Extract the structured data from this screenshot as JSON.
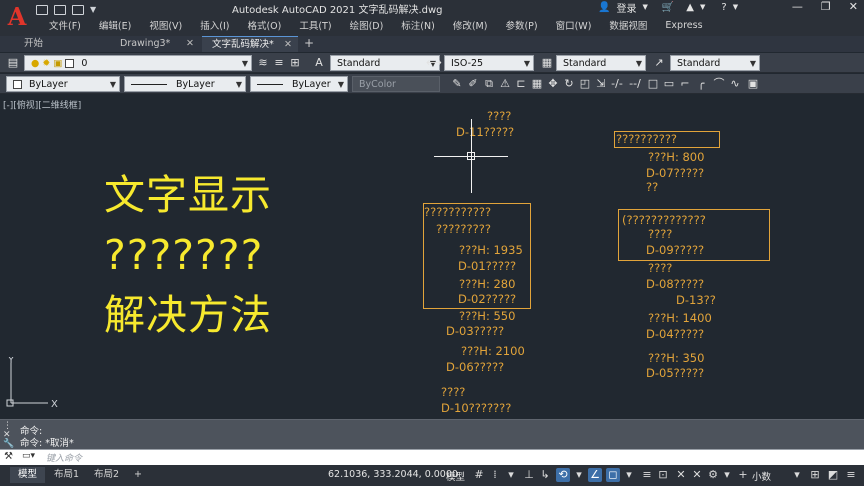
{
  "app": {
    "title": "Autodesk AutoCAD 2021    文字乱码解决.dwg",
    "account": "登录",
    "logo_letter": "A"
  },
  "menu": [
    "文件(F)",
    "编辑(E)",
    "视图(V)",
    "插入(I)",
    "格式(O)",
    "工具(T)",
    "绘图(D)",
    "标注(N)",
    "修改(M)",
    "参数(P)",
    "窗口(W)",
    "数据视图",
    "Express"
  ],
  "tabs": [
    {
      "label": "开始"
    },
    {
      "label": "Drawing3*"
    },
    {
      "label": "文字乱码解决*"
    }
  ],
  "toolbar1": {
    "layer_value": "0",
    "text_style": "Standard",
    "dim_style": "ISO-25",
    "table_style": "Standard",
    "mleader_style": "Standard"
  },
  "toolbar2": {
    "color": "ByLayer",
    "linetype": "ByLayer",
    "lineweight": "ByLayer",
    "plotstyle": "ByColor"
  },
  "viewport_label": "[-][俯视][二维线框]",
  "overlay": {
    "line1": "文字显示",
    "line2": "???????",
    "line3": "解决方法"
  },
  "drawing_texts": [
    "????",
    "D-11?????",
    "??????????",
    "???H: 800",
    "D-07?????",
    "??",
    "???????????",
    "?????????",
    "???H: 1935",
    "D-01?????",
    "???H: 280",
    "D-02?????",
    "???H: 550",
    "D-03?????",
    "???H: 2100",
    "D-06?????",
    "????",
    "D-10???????",
    "(?????????????",
    "????",
    "D-09?????",
    "????",
    "D-08?????",
    "D-13??",
    "???H: 1400",
    "D-04?????",
    "???H: 350",
    "D-05?????"
  ],
  "command": {
    "history": [
      "命令:",
      "命令: *取消*"
    ],
    "placeholder": "键入命令"
  },
  "status": {
    "tabs": [
      "模型",
      "布局1",
      "布局2"
    ],
    "coordinates": "62.1036, 333.2044, 0.0000",
    "space": "模型",
    "units": "小数"
  }
}
